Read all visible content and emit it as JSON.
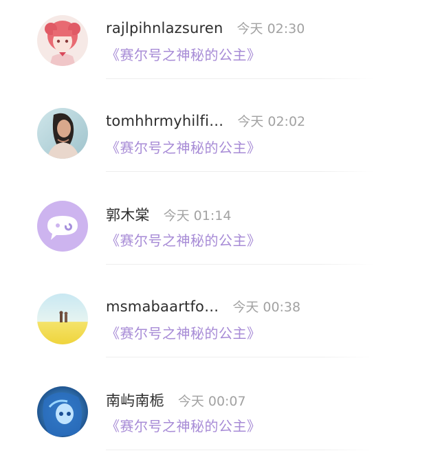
{
  "colors": {
    "username": "#2d2d2d",
    "time": "#a2a2a2",
    "book_title": "#a78bd6",
    "divider": "#eeeeee",
    "default_avatar_bg": "#cdb4ef"
  },
  "comments": [
    {
      "username": "rajlpihnlazsuren",
      "time": "今天 02:30",
      "book": "《赛尔号之神秘的公主》",
      "avatar_icon": "anime-girl-avatar"
    },
    {
      "username": "tomhhrmyhilfi…",
      "time": "今天 02:02",
      "book": "《赛尔号之神秘的公主》",
      "avatar_icon": "photo-avatar"
    },
    {
      "username": "郭木棠",
      "time": "今天 01:14",
      "book": "《赛尔号之神秘的公主》",
      "avatar_icon": "default-chat-avatar"
    },
    {
      "username": "msmabaartfo…",
      "time": "今天 00:38",
      "book": "《赛尔号之神秘的公主》",
      "avatar_icon": "landscape-avatar"
    },
    {
      "username": "南屿南栀",
      "time": "今天 00:07",
      "book": "《赛尔号之神秘的公主》",
      "avatar_icon": "blue-anime-avatar"
    }
  ]
}
